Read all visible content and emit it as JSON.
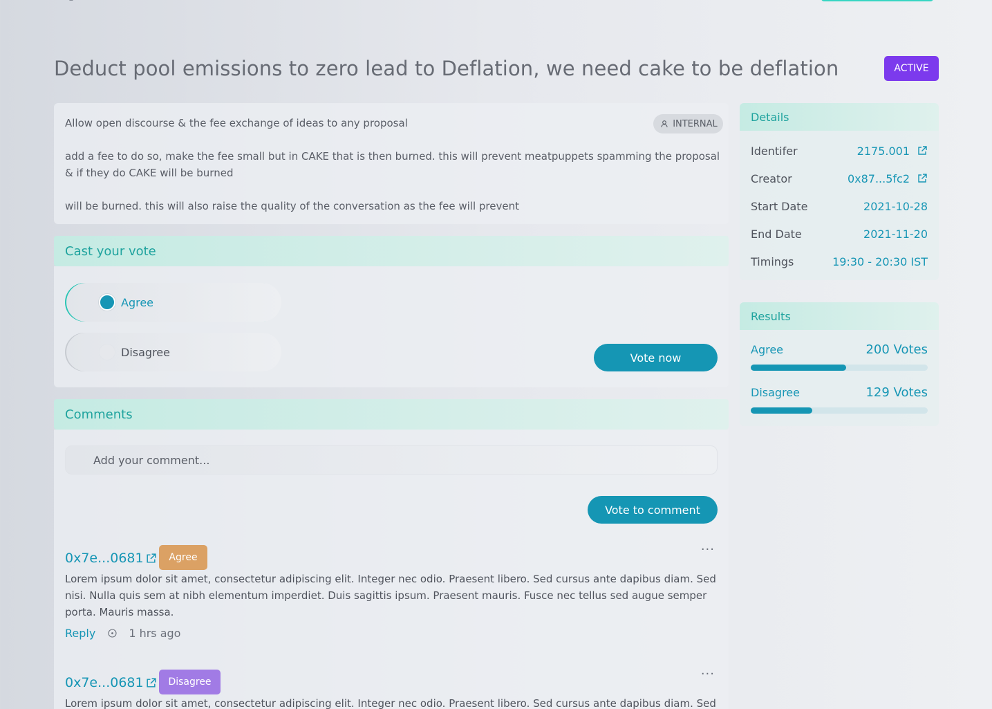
{
  "proposal": {
    "title": "Deduct pool emissions to zero lead to Deflation, we need cake to be deflation",
    "status": "ACTIVE",
    "visibility": "INTERNAL",
    "paragraphs": [
      "Allow open discourse & the fee exchange of ideas to any proposal",
      "add a fee to do so, make the fee small but in CAKE that is then burned. this will prevent meatpuppets spamming the proposal & if they do CAKE will be burned",
      "will be burned. this will also raise the quality of the conversation as the fee will prevent"
    ]
  },
  "vote": {
    "heading": "Cast your vote",
    "options": [
      {
        "label": "Agree",
        "selected": true
      },
      {
        "label": "Disagree",
        "selected": false
      }
    ],
    "button": "Vote now"
  },
  "comments": {
    "heading": "Comments",
    "placeholder": "Add your comment...",
    "button": "Vote to comment",
    "items": [
      {
        "author": "0x7e...0681",
        "stance": "Agree",
        "text": "Lorem ipsum dolor sit amet, consectetur adipiscing elit. Integer nec odio. Praesent libero. Sed cursus ante dapibus diam. Sed nisi. Nulla quis sem at nibh elementum imperdiet. Duis sagittis ipsum. Praesent mauris. Fusce nec tellus sed augue semper porta. Mauris massa.",
        "reply": "Reply",
        "time": "1 hrs ago",
        "more": "···"
      },
      {
        "author": "0x7e...0681",
        "stance": "Disagree",
        "text": "Lorem ipsum dolor sit amet, consectetur adipiscing elit. Integer nec odio. Praesent libero. Sed cursus ante dapibus diam. Sed nisi.",
        "more": "···"
      }
    ]
  },
  "details": {
    "heading": "Details",
    "rows": [
      {
        "key": "Identifer",
        "value": "2175.001"
      },
      {
        "key": "Creator",
        "value": "0x87...5fc2"
      },
      {
        "key": "Start Date",
        "value": "2021-10-28"
      },
      {
        "key": "End Date",
        "value": "2021-11-20"
      },
      {
        "key": "Timings",
        "value": "19:30 - 20:30 IST"
      }
    ]
  },
  "results": {
    "heading": "Results",
    "rows": [
      {
        "label": "Agree",
        "votes": "200 Votes",
        "fraction": 0.538
      },
      {
        "label": "Disagree",
        "votes": "129 Votes",
        "fraction": 0.347
      }
    ]
  },
  "colors": {
    "accent": "#1596b4",
    "teal": "#1fa39e",
    "status_active": "#7c3aed",
    "agree_badge": "#dba164",
    "disagree_badge": "#a17be5"
  },
  "icons": [
    "user-icon",
    "external-link-icon",
    "clock-icon",
    "more-icon"
  ]
}
